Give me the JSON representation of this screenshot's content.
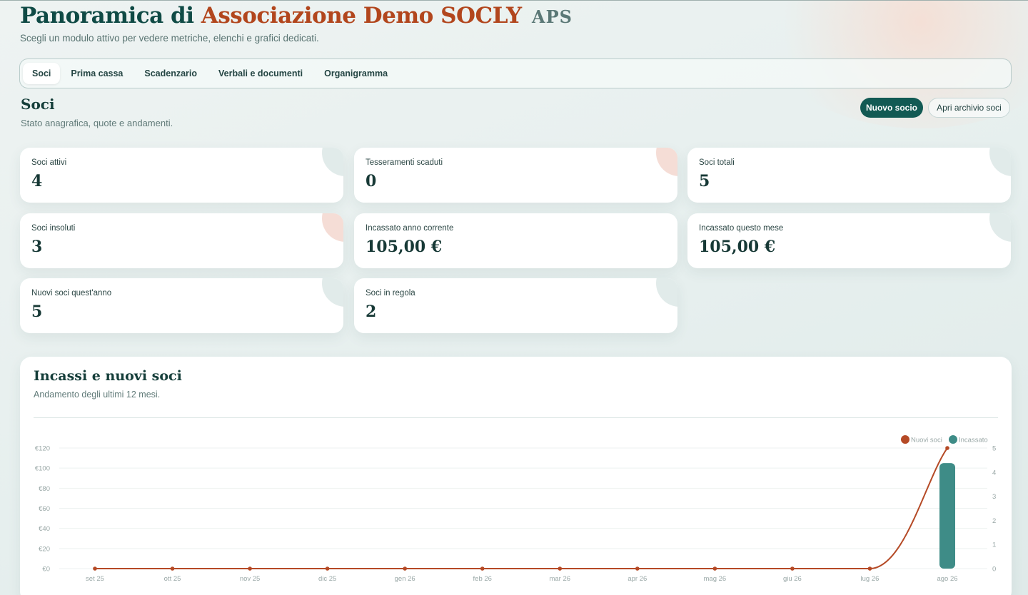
{
  "header": {
    "title_prefix": "Panoramica di",
    "title_org": "Associazione Demo SOCLY",
    "title_suffix": "APS",
    "subtitle": "Scegli un modulo attivo per vedere metriche, elenchi e grafici dedicati."
  },
  "tabs": [
    {
      "label": "Soci",
      "active": true
    },
    {
      "label": "Prima cassa",
      "active": false
    },
    {
      "label": "Scadenzario",
      "active": false
    },
    {
      "label": "Verbali e documenti",
      "active": false
    },
    {
      "label": "Organigramma",
      "active": false
    }
  ],
  "section": {
    "title": "Soci",
    "subtitle": "Stato anagrafica, quote e andamenti.",
    "primary_button": "Nuovo socio",
    "secondary_button": "Apri archivio soci"
  },
  "cards": [
    {
      "label": "Soci attivi",
      "value": "4"
    },
    {
      "label": "Tesseramenti scaduti",
      "value": "0"
    },
    {
      "label": "Soci totali",
      "value": "5"
    },
    {
      "label": "Soci insoluti",
      "value": "3"
    },
    {
      "label": "Incassato anno corrente",
      "value": "105,00 €"
    },
    {
      "label": "Incassato questo mese",
      "value": "105,00 €"
    },
    {
      "label": "Nuovi soci quest'anno",
      "value": "5"
    },
    {
      "label": "Soci in regola",
      "value": "2"
    }
  ],
  "colors": {
    "accent": "#125a54",
    "brand_orange": "#b2461d",
    "bar": "#3e8c87",
    "line": "#b54a26"
  },
  "chart": {
    "title": "Incassi e nuovi soci",
    "subtitle": "Andamento degli ultimi 12 mesi."
  },
  "chart_data": {
    "type": "bar",
    "categories": [
      "set 25",
      "ott 25",
      "nov 25",
      "dic 25",
      "gen 26",
      "feb 26",
      "mar 26",
      "apr 26",
      "mag 26",
      "giu 26",
      "lug 26",
      "ago 26"
    ],
    "series": [
      {
        "name": "Nuovi soci",
        "type": "line",
        "axis": "right",
        "values": [
          0,
          0,
          0,
          0,
          0,
          0,
          0,
          0,
          0,
          0,
          0,
          5
        ]
      },
      {
        "name": "Incassato",
        "type": "bar",
        "axis": "left",
        "values": [
          0,
          0,
          0,
          0,
          0,
          0,
          0,
          0,
          0,
          0,
          0,
          105
        ]
      }
    ],
    "left_axis": {
      "ticks": [
        "€0",
        "€20",
        "€40",
        "€60",
        "€80",
        "€100",
        "€120"
      ],
      "ylim": [
        0,
        120
      ]
    },
    "right_axis": {
      "ticks": [
        "0",
        "1",
        "2",
        "3",
        "4",
        "5"
      ],
      "ylim": [
        0,
        5
      ]
    },
    "legend_position": "top-right",
    "grid": true
  }
}
